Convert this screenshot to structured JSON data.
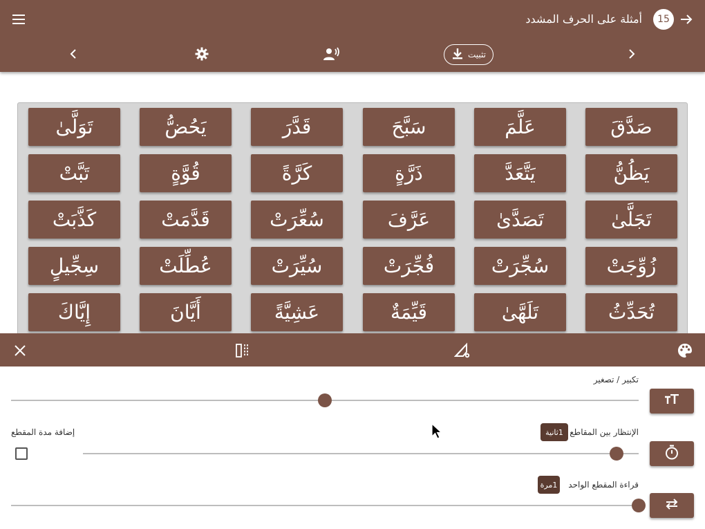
{
  "header": {
    "title": "أمثلة على الحرف المشدد",
    "lesson_number": "15",
    "install_label": "تثبيت"
  },
  "grid": {
    "rows": [
      [
        "صَدَّقَ",
        "عَلَّمَ",
        "سَبَّحَ",
        "قَدَّرَ",
        "يَحُضُّ",
        "تَوَلَّىٰ"
      ],
      [
        "يَظُنُّ",
        "يَتَّعَدَّ",
        "ذَرَّةٍ",
        "كَرَّةً",
        "قُوَّةٍ",
        "تَبَّتْ"
      ],
      [
        "تَجَلَّىٰ",
        "تَصَدَّىٰ",
        "عَرَّفَ",
        "سُعِّرَتْ",
        "قَدَّمَتْ",
        "كَذَّبَتْ"
      ],
      [
        "زُوِّجَتْ",
        "سُجِّرَتْ",
        "فُجِّرَتْ",
        "سُيِّرَتْ",
        "عُطِّلَتْ",
        "سِجِّيلٍ"
      ],
      [
        "تُحَدِّثُ",
        "تَلَهَّىٰ",
        "قَيِّمَةٌ",
        "عَشِيَّةً",
        "أَيَّانَ",
        "إِيَّاكَ"
      ]
    ]
  },
  "settings": {
    "zoom_label": "تكبير / تصغير",
    "zoom_value": 0.5,
    "pause_label": "الإنتظار بين المقاطع",
    "pause_value_text": "1ثانية",
    "pause_value": 0.96,
    "add_duration_label": "إضافة مدة المقطع",
    "add_duration_checked": false,
    "repeat_label": "قراءة المقطع الواحد",
    "repeat_value_text": "1مرة",
    "repeat_value": 1.0
  },
  "colors": {
    "primary": "#7b5447",
    "grid_background": "#d6d6d6",
    "pill": "#5a3b30"
  }
}
